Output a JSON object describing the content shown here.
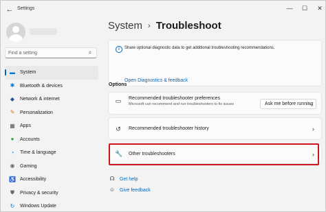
{
  "window": {
    "title": "Settings",
    "back_icon": "←",
    "min_icon": "—",
    "max_icon": "☐",
    "close_icon": "✕"
  },
  "search": {
    "placeholder": "Find a setting",
    "icon": "⌕"
  },
  "sidebar": {
    "items": [
      {
        "label": "System",
        "icon": "▬",
        "color": "#0078d4",
        "active": true
      },
      {
        "label": "Bluetooth & devices",
        "icon": "✱",
        "color": "#0078d4"
      },
      {
        "label": "Network & internet",
        "icon": "◆",
        "color": "#2b5797"
      },
      {
        "label": "Personalization",
        "icon": "✎",
        "color": "#d47a20"
      },
      {
        "label": "Apps",
        "icon": "▦",
        "color": "#555555"
      },
      {
        "label": "Accounts",
        "icon": "●",
        "color": "#2ea043"
      },
      {
        "label": "Time & language",
        "icon": "◔",
        "color": "#0078d4"
      },
      {
        "label": "Gaming",
        "icon": "◉",
        "color": "#6b6b6b"
      },
      {
        "label": "Accessibility",
        "icon": "♿",
        "color": "#1a5fb4"
      },
      {
        "label": "Privacy & security",
        "icon": "⛊",
        "color": "#6b6b6b"
      },
      {
        "label": "Windows Update",
        "icon": "↻",
        "color": "#0078d4"
      }
    ]
  },
  "breadcrumb": {
    "parent": "System",
    "separator": "›",
    "current": "Troubleshoot"
  },
  "info": {
    "icon": "i",
    "text": "Share optional diagnostic data to get additional troubleshooting recommendations.",
    "link": "Open Diagnostics & feedback"
  },
  "options": {
    "section_label": "Options",
    "preferences": {
      "icon": "▭",
      "title": "Recommended troubleshooter preferences",
      "description": "Microsoft can recommend and run troubleshooters to fix issues",
      "dropdown_value": "Ask me before running",
      "dropdown_chevron": "⌄"
    },
    "history": {
      "icon": "↺",
      "title": "Recommended troubleshooter history",
      "chevron": "›"
    },
    "other": {
      "icon": "🔧",
      "title": "Other troubleshooters",
      "chevron": "›"
    }
  },
  "help": {
    "get_help": {
      "icon": "☊",
      "label": "Get help"
    },
    "feedback": {
      "icon": "☺",
      "label": "Give feedback"
    }
  },
  "colors": {
    "accent": "#0067c0",
    "highlight": "#d0141f"
  }
}
